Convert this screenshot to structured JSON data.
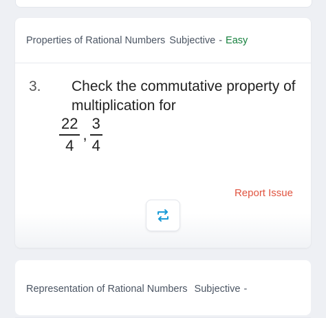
{
  "card1": {
    "topic": "Properties of Rational Numbers",
    "type": "Subjective",
    "separator": "-",
    "difficulty": "Easy",
    "question_number": "3.",
    "question_text": "Check the commutative property of multiplication for",
    "fractions": [
      {
        "numerator": "22",
        "denominator": "4"
      },
      {
        "numerator": "3",
        "denominator": "4"
      }
    ],
    "fraction_separator": ",",
    "report_label": "Report Issue"
  },
  "card2": {
    "topic": "Representation of Rational Numbers",
    "type": "Subjective",
    "separator": "-"
  },
  "colors": {
    "difficulty_easy": "#15803d",
    "report": "#e0533f",
    "accent": "#1a9bd7"
  },
  "icons": {
    "repeat": "repeat-icon"
  }
}
